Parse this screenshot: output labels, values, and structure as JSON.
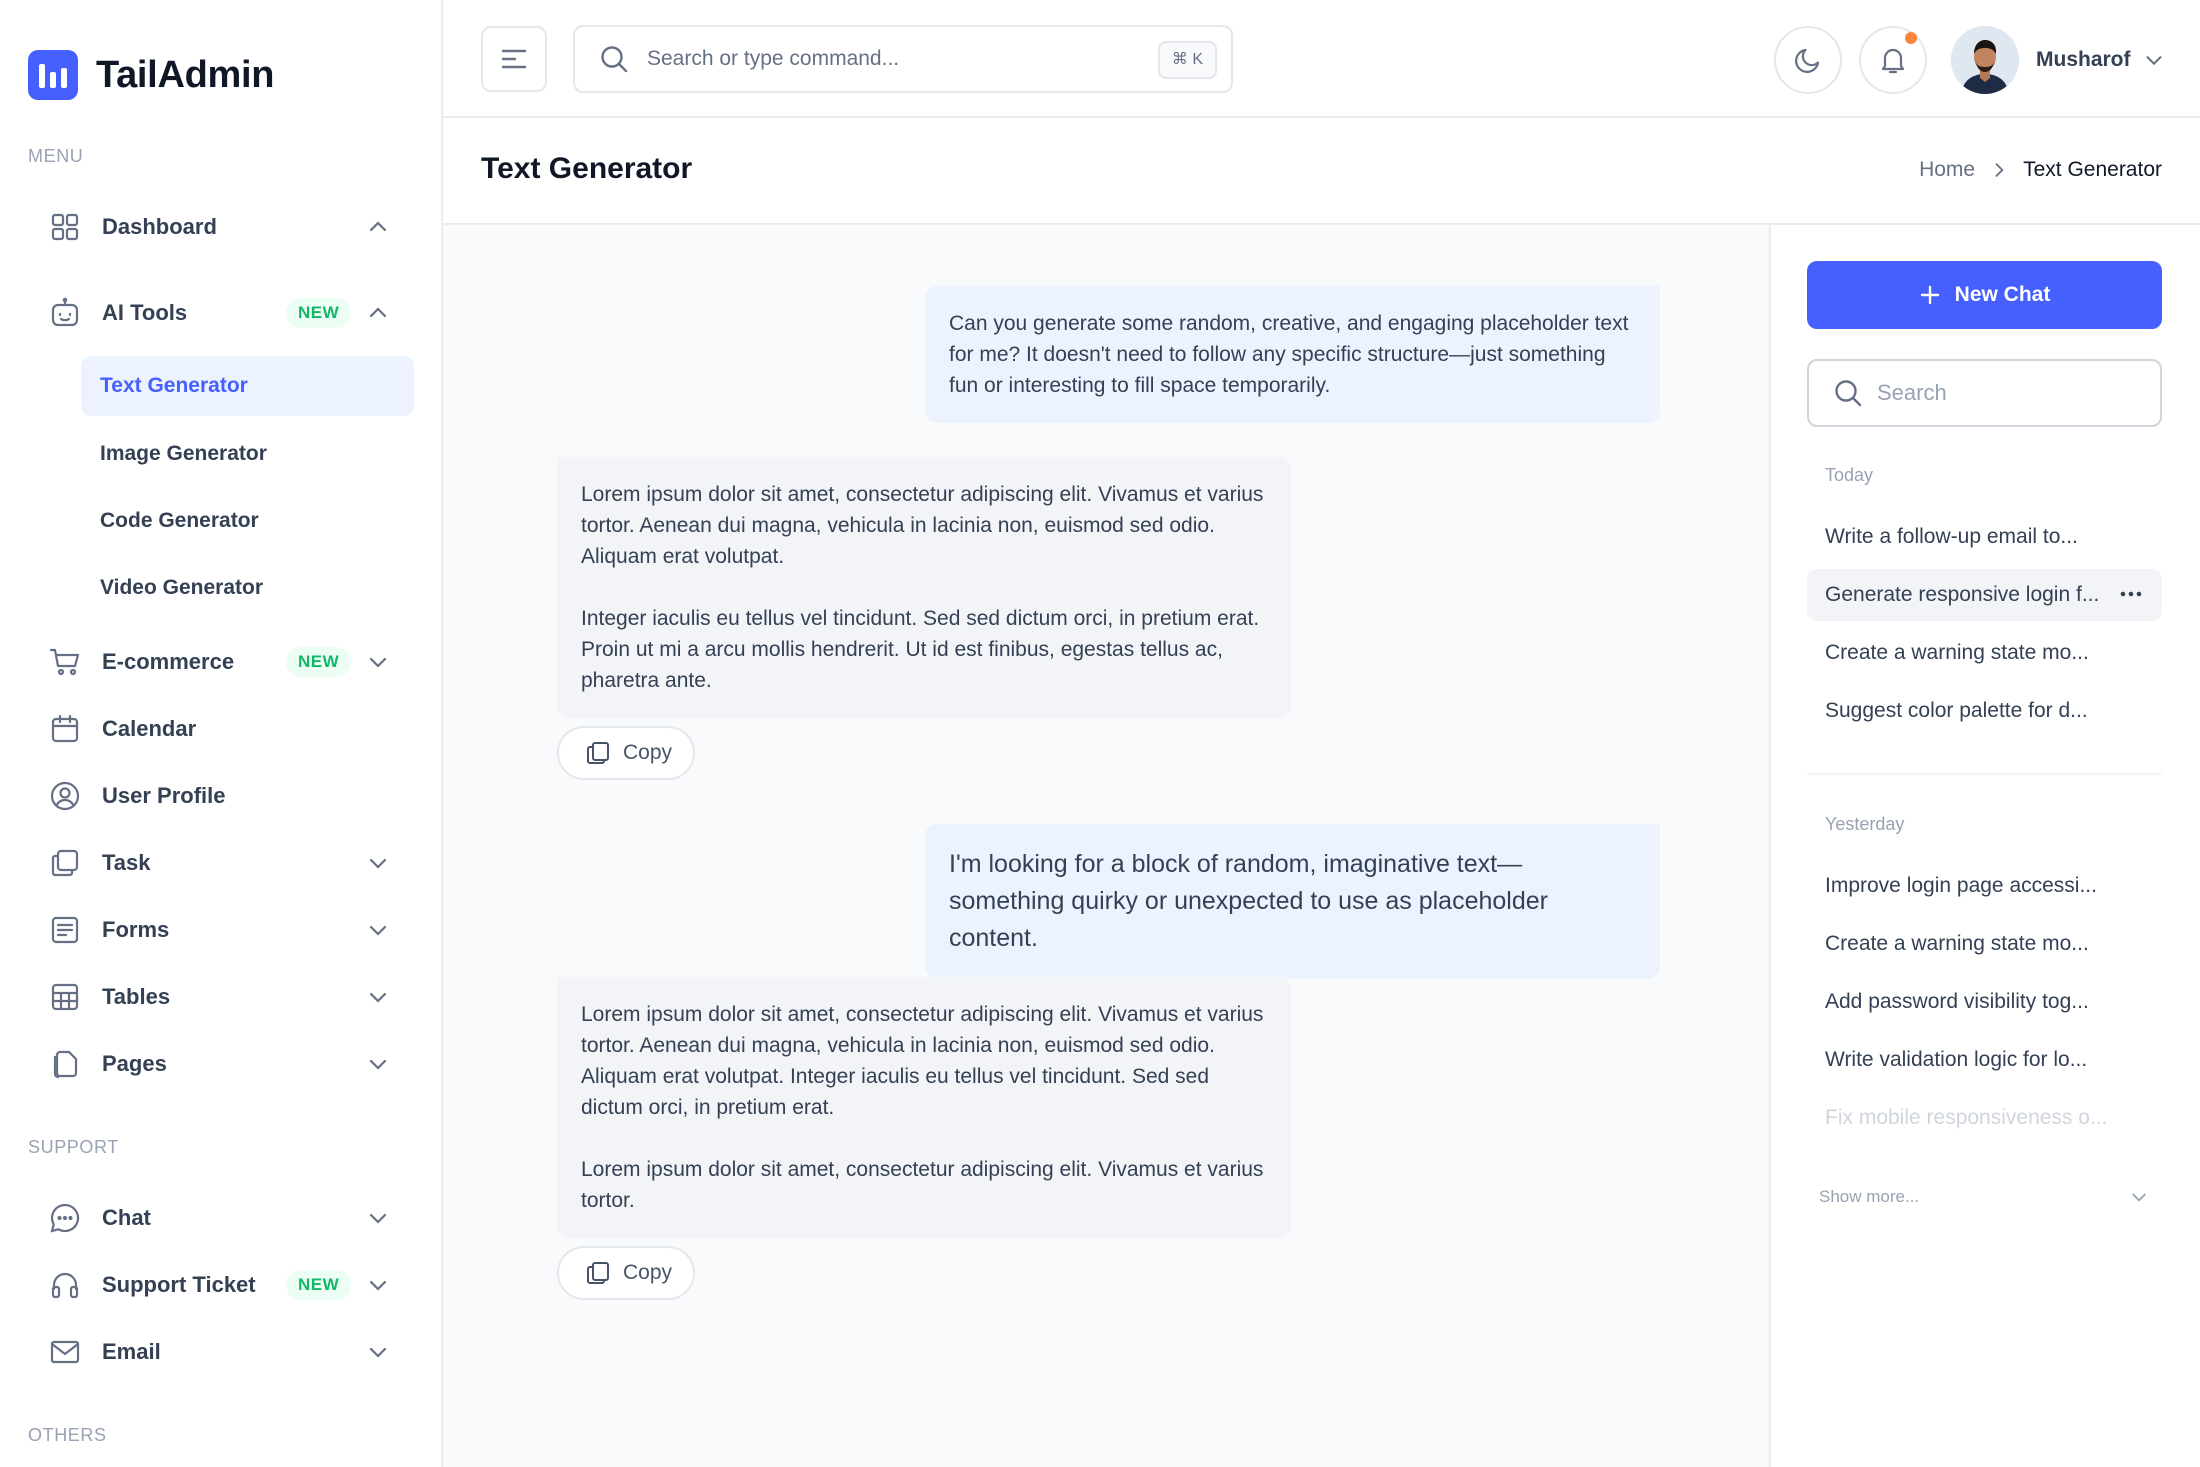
{
  "brand": {
    "name": "TailAdmin"
  },
  "sidebar": {
    "menu_label": "MENU",
    "support_label": "SUPPORT",
    "others_label": "OTHERS",
    "items": [
      {
        "label": "Dashboard",
        "icon": "grid-icon"
      },
      {
        "label": "AI Tools",
        "icon": "robot-icon",
        "badge": "NEW"
      },
      {
        "label": "E-commerce",
        "icon": "cart-icon",
        "badge": "NEW"
      },
      {
        "label": "Calendar",
        "icon": "calendar-icon"
      },
      {
        "label": "User Profile",
        "icon": "user-circle-icon"
      },
      {
        "label": "Task",
        "icon": "task-icon"
      },
      {
        "label": "Forms",
        "icon": "form-icon"
      },
      {
        "label": "Tables",
        "icon": "table-icon"
      },
      {
        "label": "Pages",
        "icon": "pages-icon"
      }
    ],
    "ai_subitems": [
      "Text Generator",
      "Image Generator",
      "Code Generator",
      "Video Generator"
    ],
    "support_items": [
      {
        "label": "Chat",
        "icon": "chat-icon"
      },
      {
        "label": "Support Ticket",
        "icon": "headset-icon",
        "badge": "NEW"
      },
      {
        "label": "Email",
        "icon": "mail-icon"
      }
    ]
  },
  "header": {
    "search_placeholder": "Search or type command...",
    "shortcut": "⌘ K",
    "user_name": "Musharof"
  },
  "page": {
    "title": "Text Generator",
    "breadcrumb": [
      "Home",
      "Text Generator"
    ]
  },
  "chat": {
    "messages": [
      {
        "role": "user",
        "text": "Can you generate some random, creative, and engaging placeholder text for me? It doesn't need to follow any specific structure—just something fun or interesting to fill space temporarily."
      },
      {
        "role": "assistant",
        "paragraphs": [
          "Lorem ipsum dolor sit amet, consectetur adipiscing elit. Vivamus et varius tortor. Aenean dui magna, vehicula in lacinia non, euismod sed odio. Aliquam erat volutpat.",
          "Integer iaculis eu tellus vel tincidunt. Sed sed dictum orci, in pretium erat. Proin ut mi a arcu mollis hendrerit. Ut id est finibus, egestas tellus ac, pharetra ante."
        ]
      },
      {
        "role": "user",
        "text": "I'm looking for a block of random, imaginative text—something quirky or unexpected to use as placeholder content."
      },
      {
        "role": "assistant",
        "paragraphs": [
          "Lorem ipsum dolor sit amet, consectetur adipiscing elit. Vivamus et varius tortor. Aenean dui magna, vehicula in lacinia non, euismod sed odio. Aliquam erat volutpat. Integer iaculis eu tellus vel tincidunt. Sed sed dictum orci, in pretium erat.",
          "Lorem ipsum dolor sit amet, consectetur adipiscing elit. Vivamus et varius tortor."
        ]
      }
    ],
    "copy_label": "Copy"
  },
  "history": {
    "new_chat_label": "New Chat",
    "search_placeholder": "Search",
    "today_label": "Today",
    "yesterday_label": "Yesterday",
    "today": [
      "Write a follow-up email to...",
      "Generate responsive login f...",
      "Create a warning state mo...",
      "Suggest color palette for d..."
    ],
    "yesterday": [
      "Improve login page accessi...",
      "Create a warning state mo...",
      "Add password visibility tog...",
      "Write validation logic for lo...",
      "Fix mobile responsiveness o..."
    ],
    "show_more": "Show more..."
  },
  "colors": {
    "accent": "#465fff",
    "badge_bg": "#ecfdf3",
    "badge_text": "#12b76a",
    "notification_dot": "#fd853a"
  }
}
